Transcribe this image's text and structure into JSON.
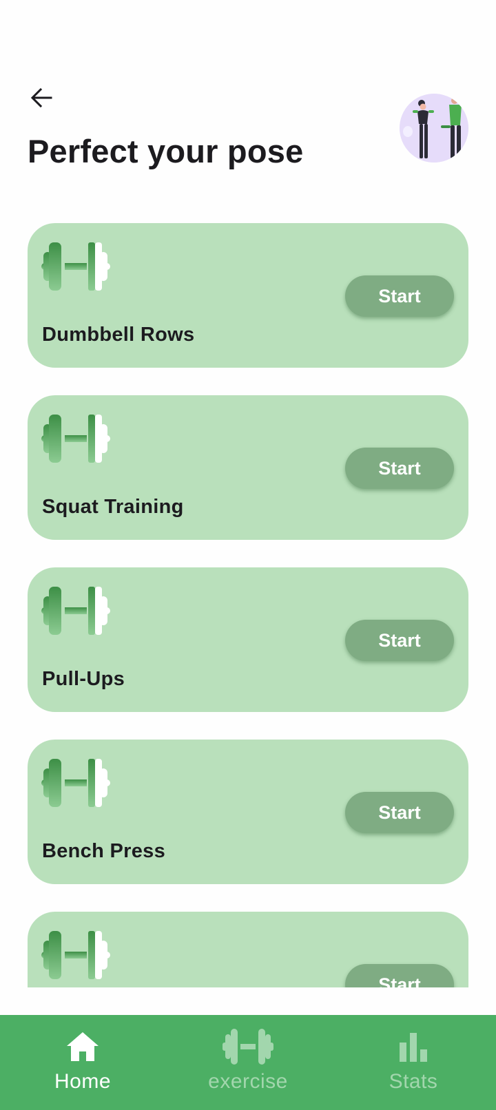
{
  "header": {
    "title": "Perfect your pose",
    "back_icon": "arrow-left-icon",
    "avatar": "fitness-illustration"
  },
  "exercises": [
    {
      "label": "Dumbbell Rows",
      "button": "Start",
      "icon": "dumbbell-icon"
    },
    {
      "label": "Squat Training",
      "button": "Start",
      "icon": "dumbbell-icon"
    },
    {
      "label": "Pull-Ups",
      "button": "Start",
      "icon": "dumbbell-icon"
    },
    {
      "label": "Bench Press",
      "button": "Start",
      "icon": "dumbbell-icon"
    },
    {
      "label": "",
      "button": "Start",
      "icon": "dumbbell-icon"
    }
  ],
  "nav": {
    "items": [
      {
        "label": "Home",
        "icon": "home-icon",
        "active": true
      },
      {
        "label": "exercise",
        "icon": "dumbbell-icon",
        "active": false
      },
      {
        "label": "Stats",
        "icon": "bar-chart-icon",
        "active": false
      }
    ]
  },
  "colors": {
    "card": "#b9e0bb",
    "button": "#7fac83",
    "nav_bar": "#4caf64",
    "nav_active": "#ffffff",
    "nav_inactive": "#a2d6ad",
    "title_text": "#1c1b1f"
  }
}
